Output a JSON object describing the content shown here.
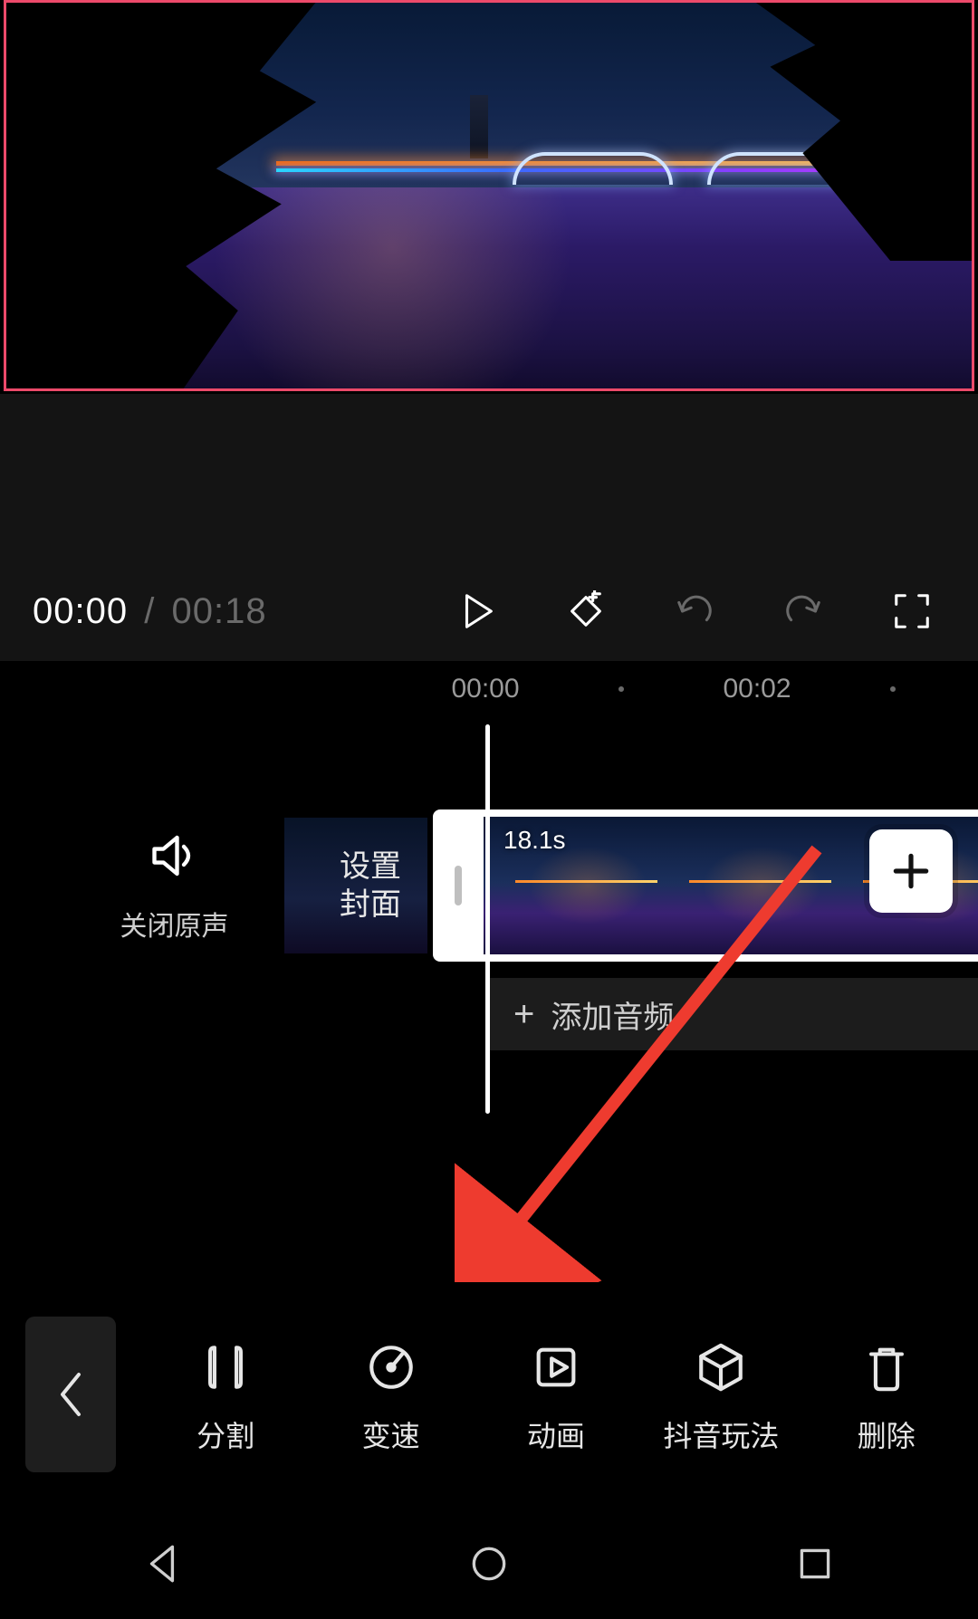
{
  "playback": {
    "current": "00:00",
    "separator": "/",
    "total": "00:18"
  },
  "ruler": {
    "mark0": "00:00",
    "mark1": "00:02"
  },
  "timeline": {
    "mute_label": "关闭原声",
    "cover_label": "设置\n封面",
    "clip_duration": "18.1s",
    "add_audio_label": "添加音频"
  },
  "tools": {
    "split": "分割",
    "speed": "变速",
    "animate": "动画",
    "douyin": "抖音玩法",
    "delete": "删除"
  },
  "icons": {
    "play": "play-icon",
    "keyframe": "keyframe-icon",
    "undo": "undo-icon",
    "redo": "redo-icon",
    "fullscreen": "fullscreen-icon",
    "speaker": "speaker-icon",
    "plus": "plus-icon",
    "back": "back-icon"
  }
}
